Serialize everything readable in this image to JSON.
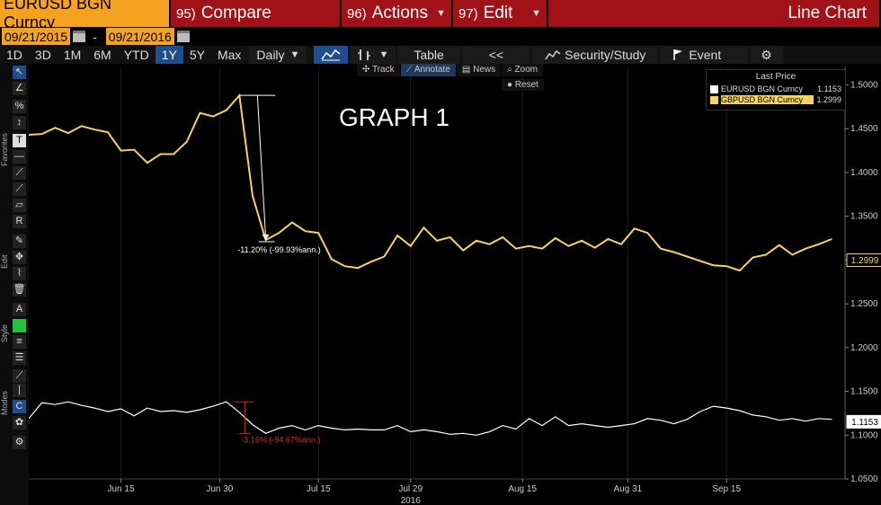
{
  "topbar": {
    "ticker": "EURUSD BGN Curncy",
    "compare_num": "95)",
    "compare_label": "Compare",
    "actions_num": "96)",
    "actions_label": "Actions",
    "edit_num": "97)",
    "edit_label": "Edit",
    "view_name": "Line Chart"
  },
  "dates": {
    "start": "09/21/2015",
    "separator": "-",
    "end": "09/21/2016"
  },
  "periods": [
    {
      "label": "1D",
      "selected": false
    },
    {
      "label": "3D",
      "selected": false
    },
    {
      "label": "1M",
      "selected": false
    },
    {
      "label": "6M",
      "selected": false
    },
    {
      "label": "YTD",
      "selected": false
    },
    {
      "label": "1Y",
      "selected": true
    },
    {
      "label": "5Y",
      "selected": false
    },
    {
      "label": "Max",
      "selected": false
    }
  ],
  "toolbar": {
    "frequency": "Daily",
    "table_label": "Table",
    "back_label": "<<",
    "security_study_label": "Security/Study",
    "event_label": "Event"
  },
  "chart_tools": {
    "track": "Track",
    "annotate": "Annotate",
    "news": "News",
    "zoom": "Zoom",
    "reset": "Reset"
  },
  "sidebar": {
    "favorites": "Favorites",
    "edit": "Edit",
    "style": "Style",
    "modes": "Modes"
  },
  "graph_label": "GRAPH 1",
  "legend": {
    "title": "Last Price",
    "items": [
      {
        "name": "EURUSD BGN Curncy",
        "value": "1.1153",
        "color": "#ffffff"
      },
      {
        "name": "GBPUSD BGN Curncy",
        "value": "1.2999",
        "color": "#f4d35e"
      }
    ]
  },
  "annotations": {
    "gbp_drop": "-11.20% (-99.93%ann.)",
    "eur_drop": "-3.16% (-94.67%ann.)"
  },
  "chart_data": {
    "type": "line",
    "ylim": [
      1.05,
      1.52
    ],
    "yticks": [
      "1.5000",
      "1.4500",
      "1.4000",
      "1.3500",
      "1.3000",
      "1.2500",
      "1.2000",
      "1.1500",
      "1.1000",
      "1.0500"
    ],
    "xtick_labels": [
      "Jun 15",
      "Jun 30",
      "Jul 15",
      "Jul 29",
      "Aug 15",
      "Aug 31",
      "Sep 15"
    ],
    "xtick_days": [
      14,
      29,
      44,
      58,
      75,
      91,
      106
    ],
    "year_label": "2016",
    "xlim": [
      0,
      124
    ],
    "series": [
      {
        "name": "GBPUSD BGN Curncy",
        "color": "#f4d35e",
        "last": "1.2999",
        "points": [
          [
            0,
            1.443
          ],
          [
            2,
            1.444
          ],
          [
            4,
            1.451
          ],
          [
            6,
            1.445
          ],
          [
            8,
            1.453
          ],
          [
            10,
            1.449
          ],
          [
            12,
            1.446
          ],
          [
            14,
            1.425
          ],
          [
            16,
            1.426
          ],
          [
            18,
            1.411
          ],
          [
            20,
            1.421
          ],
          [
            22,
            1.421
          ],
          [
            24,
            1.435
          ],
          [
            26,
            1.468
          ],
          [
            28,
            1.464
          ],
          [
            30,
            1.471
          ],
          [
            32,
            1.488
          ],
          [
            34,
            1.373
          ],
          [
            36,
            1.323
          ],
          [
            38,
            1.331
          ],
          [
            40,
            1.343
          ],
          [
            42,
            1.333
          ],
          [
            44,
            1.331
          ],
          [
            46,
            1.301
          ],
          [
            48,
            1.293
          ],
          [
            50,
            1.291
          ],
          [
            52,
            1.298
          ],
          [
            54,
            1.304
          ],
          [
            56,
            1.328
          ],
          [
            58,
            1.316
          ],
          [
            60,
            1.337
          ],
          [
            62,
            1.322
          ],
          [
            64,
            1.326
          ],
          [
            66,
            1.311
          ],
          [
            68,
            1.322
          ],
          [
            70,
            1.318
          ],
          [
            72,
            1.326
          ],
          [
            74,
            1.313
          ],
          [
            76,
            1.316
          ],
          [
            78,
            1.313
          ],
          [
            80,
            1.325
          ],
          [
            82,
            1.316
          ],
          [
            84,
            1.322
          ],
          [
            86,
            1.314
          ],
          [
            88,
            1.324
          ],
          [
            90,
            1.318
          ],
          [
            92,
            1.336
          ],
          [
            94,
            1.331
          ],
          [
            96,
            1.313
          ],
          [
            98,
            1.309
          ],
          [
            100,
            1.304
          ],
          [
            102,
            1.299
          ],
          [
            104,
            1.294
          ],
          [
            106,
            1.293
          ],
          [
            108,
            1.288
          ],
          [
            110,
            1.303
          ],
          [
            112,
            1.306
          ],
          [
            114,
            1.317
          ],
          [
            116,
            1.306
          ],
          [
            118,
            1.313
          ],
          [
            120,
            1.318
          ],
          [
            122,
            1.324
          ]
        ]
      },
      {
        "name": "EURUSD BGN Curncy",
        "color": "#ffffff",
        "last": "1.1153",
        "points": [
          [
            0,
            1.119
          ],
          [
            2,
            1.137
          ],
          [
            4,
            1.135
          ],
          [
            6,
            1.138
          ],
          [
            8,
            1.134
          ],
          [
            10,
            1.131
          ],
          [
            12,
            1.127
          ],
          [
            14,
            1.13
          ],
          [
            16,
            1.122
          ],
          [
            18,
            1.131
          ],
          [
            20,
            1.127
          ],
          [
            22,
            1.128
          ],
          [
            24,
            1.126
          ],
          [
            26,
            1.129
          ],
          [
            28,
            1.133
          ],
          [
            30,
            1.138
          ],
          [
            32,
            1.126
          ],
          [
            34,
            1.112
          ],
          [
            36,
            1.102
          ],
          [
            38,
            1.108
          ],
          [
            40,
            1.111
          ],
          [
            42,
            1.106
          ],
          [
            44,
            1.111
          ],
          [
            46,
            1.108
          ],
          [
            48,
            1.106
          ],
          [
            50,
            1.107
          ],
          [
            52,
            1.106
          ],
          [
            54,
            1.106
          ],
          [
            56,
            1.111
          ],
          [
            58,
            1.104
          ],
          [
            60,
            1.106
          ],
          [
            62,
            1.104
          ],
          [
            64,
            1.101
          ],
          [
            66,
            1.102
          ],
          [
            68,
            1.1
          ],
          [
            70,
            1.104
          ],
          [
            72,
            1.111
          ],
          [
            74,
            1.107
          ],
          [
            76,
            1.119
          ],
          [
            78,
            1.111
          ],
          [
            80,
            1.121
          ],
          [
            82,
            1.111
          ],
          [
            84,
            1.113
          ],
          [
            86,
            1.111
          ],
          [
            88,
            1.109
          ],
          [
            90,
            1.111
          ],
          [
            92,
            1.113
          ],
          [
            94,
            1.119
          ],
          [
            96,
            1.117
          ],
          [
            98,
            1.113
          ],
          [
            100,
            1.118
          ],
          [
            102,
            1.127
          ],
          [
            104,
            1.133
          ],
          [
            106,
            1.131
          ],
          [
            108,
            1.128
          ],
          [
            110,
            1.123
          ],
          [
            112,
            1.121
          ],
          [
            114,
            1.117
          ],
          [
            116,
            1.119
          ],
          [
            118,
            1.116
          ],
          [
            120,
            1.119
          ],
          [
            122,
            1.118
          ]
        ]
      }
    ]
  },
  "colors": {
    "gbp": "#f4d35e",
    "eur": "#ffffff",
    "annot_red": "#d0302a",
    "grid": "#2a2a2a"
  }
}
